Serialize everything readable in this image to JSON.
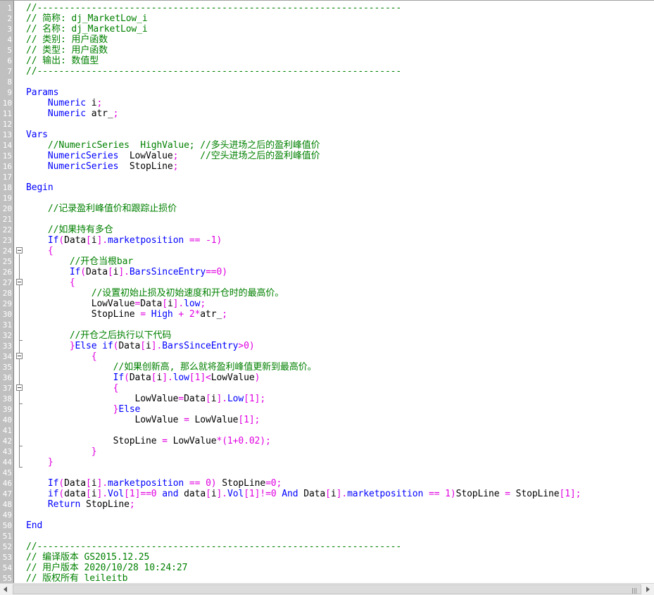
{
  "lines": [
    {
      "n": "1",
      "segs": [
        {
          "t": "//-------------------------------------------------------------------",
          "s": "c"
        }
      ]
    },
    {
      "n": "2",
      "segs": [
        {
          "t": "// 简称: dj_MarketLow_i",
          "s": "c"
        }
      ]
    },
    {
      "n": "3",
      "segs": [
        {
          "t": "// 名称: dj_MarketLow_i",
          "s": "c"
        }
      ]
    },
    {
      "n": "4",
      "segs": [
        {
          "t": "// 类别: 用户函数",
          "s": "c"
        }
      ]
    },
    {
      "n": "5",
      "segs": [
        {
          "t": "// 类型: 用户函数",
          "s": "c"
        }
      ]
    },
    {
      "n": "6",
      "segs": [
        {
          "t": "// 输出: 数值型",
          "s": "c"
        }
      ]
    },
    {
      "n": "7",
      "segs": [
        {
          "t": "//-------------------------------------------------------------------",
          "s": "c"
        }
      ]
    },
    {
      "n": "8",
      "segs": []
    },
    {
      "n": "9",
      "segs": [
        {
          "t": "Params",
          "s": "k"
        }
      ]
    },
    {
      "n": "10",
      "segs": [
        {
          "t": "    Numeric",
          "s": "k"
        },
        {
          "t": " i",
          "s": "x"
        },
        {
          "t": ";",
          "s": "p"
        }
      ]
    },
    {
      "n": "11",
      "segs": [
        {
          "t": "    Numeric",
          "s": "k"
        },
        {
          "t": " atr_",
          "s": "x"
        },
        {
          "t": ";",
          "s": "p"
        }
      ]
    },
    {
      "n": "12",
      "segs": []
    },
    {
      "n": "13",
      "segs": [
        {
          "t": "Vars",
          "s": "k"
        }
      ]
    },
    {
      "n": "14",
      "segs": [
        {
          "t": "    //NumericSeries  HighValue; //多头进场之后的盈利峰值价",
          "s": "c"
        }
      ]
    },
    {
      "n": "15",
      "segs": [
        {
          "t": "    NumericSeries",
          "s": "k"
        },
        {
          "t": "  LowValue",
          "s": "x"
        },
        {
          "t": ";",
          "s": "p"
        },
        {
          "t": "    ",
          "s": "x"
        },
        {
          "t": "//空头进场之后的盈利峰值价",
          "s": "c"
        }
      ]
    },
    {
      "n": "16",
      "segs": [
        {
          "t": "    NumericSeries",
          "s": "k"
        },
        {
          "t": "  StopLine",
          "s": "x"
        },
        {
          "t": ";",
          "s": "p"
        }
      ]
    },
    {
      "n": "17",
      "segs": []
    },
    {
      "n": "18",
      "segs": [
        {
          "t": "Begin",
          "s": "k"
        }
      ]
    },
    {
      "n": "19",
      "segs": []
    },
    {
      "n": "20",
      "segs": [
        {
          "t": "    //记录盈利峰值价和跟踪止损价",
          "s": "c"
        }
      ]
    },
    {
      "n": "21",
      "segs": []
    },
    {
      "n": "22",
      "segs": [
        {
          "t": "    //如果持有多仓",
          "s": "c"
        }
      ]
    },
    {
      "n": "23",
      "segs": [
        {
          "t": "    If",
          "s": "k"
        },
        {
          "t": "(",
          "s": "p"
        },
        {
          "t": "Data",
          "s": "x"
        },
        {
          "t": "[",
          "s": "p"
        },
        {
          "t": "i",
          "s": "x"
        },
        {
          "t": "].",
          "s": "p"
        },
        {
          "t": "marketposition",
          "s": "k"
        },
        {
          "t": " == -1)",
          "s": "p"
        }
      ]
    },
    {
      "n": "24",
      "segs": [
        {
          "t": "    {",
          "s": "p"
        }
      ]
    },
    {
      "n": "25",
      "segs": [
        {
          "t": "        //开仓当根bar",
          "s": "c"
        }
      ]
    },
    {
      "n": "26",
      "segs": [
        {
          "t": "        If",
          "s": "k"
        },
        {
          "t": "(",
          "s": "p"
        },
        {
          "t": "Data",
          "s": "x"
        },
        {
          "t": "[",
          "s": "p"
        },
        {
          "t": "i",
          "s": "x"
        },
        {
          "t": "].",
          "s": "p"
        },
        {
          "t": "BarsSinceEntry",
          "s": "k"
        },
        {
          "t": "==0)",
          "s": "p"
        }
      ]
    },
    {
      "n": "27",
      "segs": [
        {
          "t": "        {",
          "s": "p"
        }
      ]
    },
    {
      "n": "28",
      "segs": [
        {
          "t": "            //设置初始止损及初始速度和开仓时的最高价。",
          "s": "c"
        }
      ]
    },
    {
      "n": "29",
      "segs": [
        {
          "t": "            LowValue",
          "s": "x"
        },
        {
          "t": "=",
          "s": "p"
        },
        {
          "t": "Data",
          "s": "x"
        },
        {
          "t": "[",
          "s": "p"
        },
        {
          "t": "i",
          "s": "x"
        },
        {
          "t": "].",
          "s": "p"
        },
        {
          "t": "low",
          "s": "k"
        },
        {
          "t": ";",
          "s": "p"
        }
      ]
    },
    {
      "n": "30",
      "segs": [
        {
          "t": "            StopLine",
          "s": "x"
        },
        {
          "t": " = ",
          "s": "p"
        },
        {
          "t": "High",
          "s": "k"
        },
        {
          "t": " + 2*",
          "s": "p"
        },
        {
          "t": "atr_",
          "s": "x"
        },
        {
          "t": ";",
          "s": "p"
        }
      ]
    },
    {
      "n": "31",
      "segs": []
    },
    {
      "n": "32",
      "segs": [
        {
          "t": "        //开仓之后执行以下代码",
          "s": "c"
        }
      ]
    },
    {
      "n": "33",
      "segs": [
        {
          "t": "        }",
          "s": "p"
        },
        {
          "t": "Else if",
          "s": "k"
        },
        {
          "t": "(",
          "s": "p"
        },
        {
          "t": "Data",
          "s": "x"
        },
        {
          "t": "[",
          "s": "p"
        },
        {
          "t": "i",
          "s": "x"
        },
        {
          "t": "].",
          "s": "p"
        },
        {
          "t": "BarsSinceEntry",
          "s": "k"
        },
        {
          "t": ">0)",
          "s": "p"
        }
      ]
    },
    {
      "n": "34",
      "segs": [
        {
          "t": "            {",
          "s": "p"
        }
      ]
    },
    {
      "n": "35",
      "segs": [
        {
          "t": "                //如果创新高, 那么就将盈利峰值更新到最高价。",
          "s": "c"
        }
      ]
    },
    {
      "n": "36",
      "segs": [
        {
          "t": "                If",
          "s": "k"
        },
        {
          "t": "(",
          "s": "p"
        },
        {
          "t": "Data",
          "s": "x"
        },
        {
          "t": "[",
          "s": "p"
        },
        {
          "t": "i",
          "s": "x"
        },
        {
          "t": "].",
          "s": "p"
        },
        {
          "t": "low",
          "s": "k"
        },
        {
          "t": "[1]<",
          "s": "p"
        },
        {
          "t": "LowValue",
          "s": "x"
        },
        {
          "t": ")",
          "s": "p"
        }
      ]
    },
    {
      "n": "37",
      "segs": [
        {
          "t": "                {",
          "s": "p"
        }
      ]
    },
    {
      "n": "38",
      "segs": [
        {
          "t": "                    LowValue",
          "s": "x"
        },
        {
          "t": "=",
          "s": "p"
        },
        {
          "t": "Data",
          "s": "x"
        },
        {
          "t": "[",
          "s": "p"
        },
        {
          "t": "i",
          "s": "x"
        },
        {
          "t": "].",
          "s": "p"
        },
        {
          "t": "Low",
          "s": "k"
        },
        {
          "t": "[1];",
          "s": "p"
        }
      ]
    },
    {
      "n": "39",
      "segs": [
        {
          "t": "                }",
          "s": "p"
        },
        {
          "t": "Else",
          "s": "k"
        }
      ]
    },
    {
      "n": "40",
      "segs": [
        {
          "t": "                    LowValue",
          "s": "x"
        },
        {
          "t": " = ",
          "s": "p"
        },
        {
          "t": "LowValue",
          "s": "x"
        },
        {
          "t": "[1];",
          "s": "p"
        }
      ]
    },
    {
      "n": "41",
      "segs": []
    },
    {
      "n": "42",
      "segs": [
        {
          "t": "                StopLine",
          "s": "x"
        },
        {
          "t": " = ",
          "s": "p"
        },
        {
          "t": "LowValue",
          "s": "x"
        },
        {
          "t": "*(1+0.02);",
          "s": "p"
        }
      ]
    },
    {
      "n": "43",
      "segs": [
        {
          "t": "            }",
          "s": "p"
        }
      ]
    },
    {
      "n": "44",
      "segs": [
        {
          "t": "    }",
          "s": "p"
        }
      ]
    },
    {
      "n": "45",
      "segs": []
    },
    {
      "n": "46",
      "segs": [
        {
          "t": "    If",
          "s": "k"
        },
        {
          "t": "(",
          "s": "p"
        },
        {
          "t": "Data",
          "s": "x"
        },
        {
          "t": "[",
          "s": "p"
        },
        {
          "t": "i",
          "s": "x"
        },
        {
          "t": "].",
          "s": "p"
        },
        {
          "t": "marketposition",
          "s": "k"
        },
        {
          "t": " == 0) ",
          "s": "p"
        },
        {
          "t": "StopLine",
          "s": "x"
        },
        {
          "t": "=0;",
          "s": "p"
        }
      ]
    },
    {
      "n": "47",
      "segs": [
        {
          "t": "    if",
          "s": "k"
        },
        {
          "t": "(",
          "s": "p"
        },
        {
          "t": "data",
          "s": "x"
        },
        {
          "t": "[",
          "s": "p"
        },
        {
          "t": "i",
          "s": "x"
        },
        {
          "t": "].",
          "s": "p"
        },
        {
          "t": "Vol",
          "s": "k"
        },
        {
          "t": "[1]==0 ",
          "s": "p"
        },
        {
          "t": "and",
          "s": "k"
        },
        {
          "t": " data",
          "s": "x"
        },
        {
          "t": "[",
          "s": "p"
        },
        {
          "t": "i",
          "s": "x"
        },
        {
          "t": "].",
          "s": "p"
        },
        {
          "t": "Vol",
          "s": "k"
        },
        {
          "t": "[1]!=0 ",
          "s": "p"
        },
        {
          "t": "And",
          "s": "k"
        },
        {
          "t": " Data",
          "s": "x"
        },
        {
          "t": "[",
          "s": "p"
        },
        {
          "t": "i",
          "s": "x"
        },
        {
          "t": "].",
          "s": "p"
        },
        {
          "t": "marketposition",
          "s": "k"
        },
        {
          "t": " == 1)",
          "s": "p"
        },
        {
          "t": "StopLine",
          "s": "x"
        },
        {
          "t": " = ",
          "s": "p"
        },
        {
          "t": "StopLine",
          "s": "x"
        },
        {
          "t": "[1];",
          "s": "p"
        }
      ]
    },
    {
      "n": "48",
      "segs": [
        {
          "t": "    Return",
          "s": "k"
        },
        {
          "t": " StopLine",
          "s": "x"
        },
        {
          "t": ";",
          "s": "p"
        }
      ]
    },
    {
      "n": "49",
      "segs": []
    },
    {
      "n": "50",
      "segs": [
        {
          "t": "End",
          "s": "k"
        }
      ]
    },
    {
      "n": "51",
      "segs": []
    },
    {
      "n": "52",
      "segs": [
        {
          "t": "//-------------------------------------------------------------------",
          "s": "c"
        }
      ]
    },
    {
      "n": "53",
      "segs": [
        {
          "t": "// 编译版本 GS2015.12.25",
          "s": "c"
        }
      ]
    },
    {
      "n": "54",
      "segs": [
        {
          "t": "// 用户版本 2020/10/28 10:24:27",
          "s": "c"
        }
      ]
    },
    {
      "n": "55",
      "segs": [
        {
          "t": "// 版权所有 leileitb",
          "s": "c"
        }
      ]
    }
  ],
  "scrollbar": {
    "grip": "|||"
  },
  "colors": {
    "comment": "#008000",
    "keyword": "#0000ff",
    "punct": "#e000e0",
    "text": "#000000",
    "gutter": "#c0c0c0"
  }
}
